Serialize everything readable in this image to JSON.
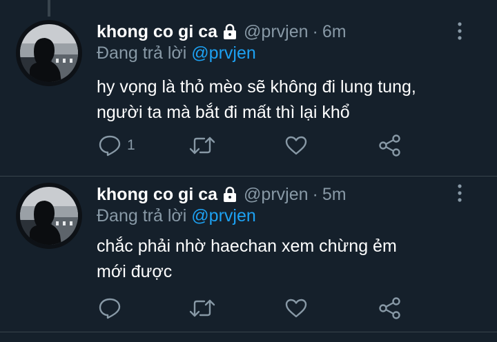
{
  "colors": {
    "background": "#15202b",
    "text_primary": "#ffffff",
    "text_secondary": "#8899a6",
    "accent": "#1da1f2",
    "divider": "#38444d"
  },
  "tweets": [
    {
      "author_name": "khong co gi ca",
      "protected_icon": "lock-icon",
      "handle": "@prvjen",
      "separator": "·",
      "time": "6m",
      "replying_prefix": "Đang trả lời",
      "replying_to": "@prvjen",
      "text_lines": [
        "hy vọng là thỏ mèo sẽ không đi lung tung,",
        "người ta mà bắt đi mất thì lại khổ"
      ],
      "reply_count": "1",
      "icons": [
        "reply-icon",
        "retweet-icon",
        "like-icon",
        "share-icon",
        "more-icon"
      ]
    },
    {
      "author_name": "khong co gi ca",
      "protected_icon": "lock-icon",
      "handle": "@prvjen",
      "separator": "·",
      "time": "5m",
      "replying_prefix": "Đang trả lời",
      "replying_to": "@prvjen",
      "text_lines": [
        "chắc phải nhờ haechan xem chừng ẻm",
        "mới được"
      ],
      "reply_count": "",
      "icons": [
        "reply-icon",
        "retweet-icon",
        "like-icon",
        "share-icon",
        "more-icon"
      ]
    }
  ]
}
